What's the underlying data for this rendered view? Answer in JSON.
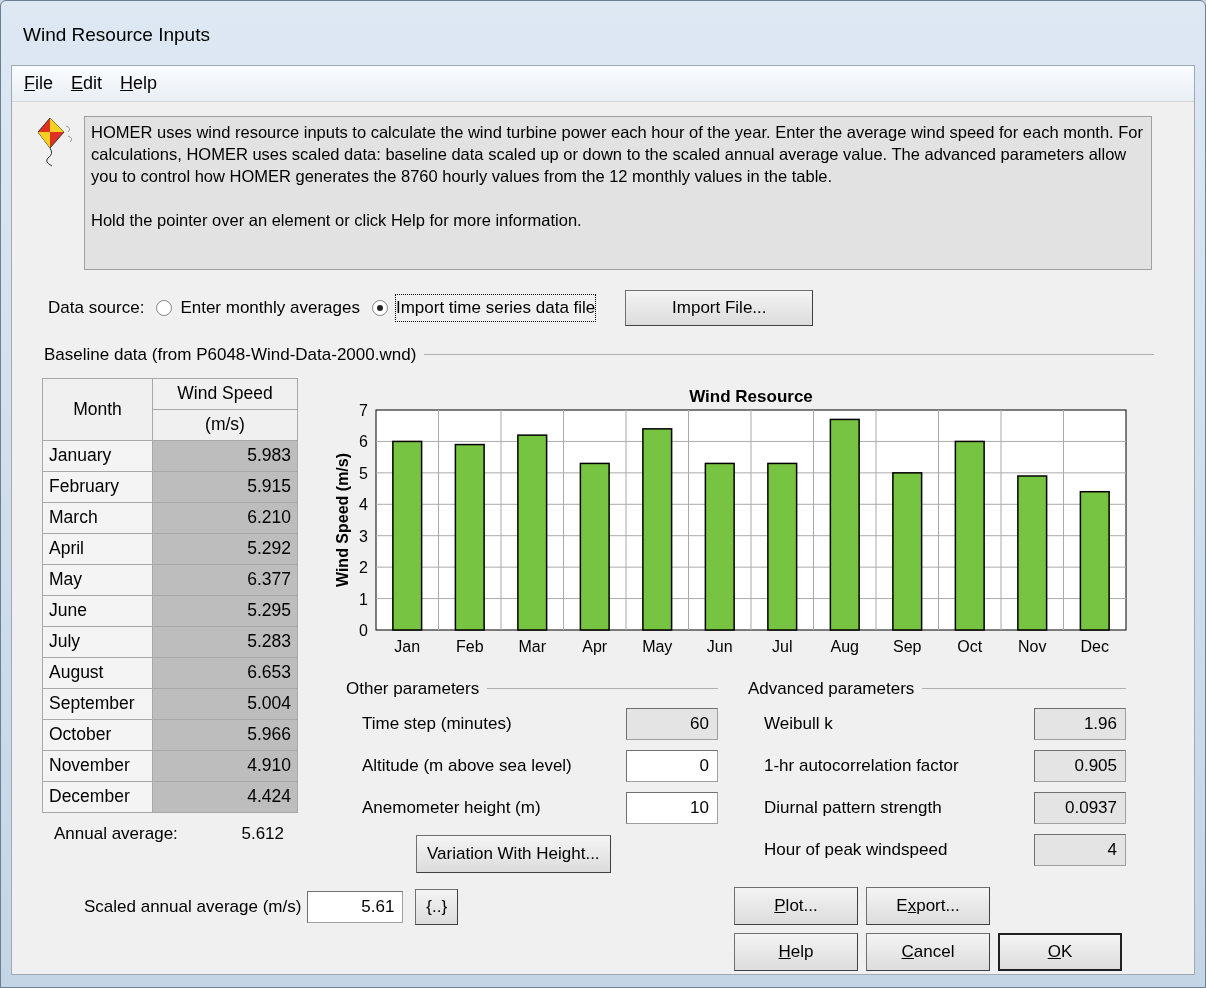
{
  "window": {
    "title": "Wind Resource Inputs"
  },
  "menu": [
    {
      "key": "F",
      "post": "ile"
    },
    {
      "key": "E",
      "post": "dit"
    },
    {
      "key": "H",
      "post": "elp"
    }
  ],
  "info": {
    "paragraphs": [
      "HOMER uses wind resource inputs to calculate the wind turbine power each hour of the year. Enter the average wind speed for each month. For calculations, HOMER uses scaled data: baseline data scaled up or down to the scaled annual average value. The advanced parameters allow you to control how HOMER generates the 8760 hourly values from the 12 monthly values in the table.",
      "Hold the pointer over an element or click Help for more information."
    ]
  },
  "data_source": {
    "label": "Data source:",
    "options": [
      {
        "label": "Enter monthly averages",
        "selected": false
      },
      {
        "label": "Import time series data file",
        "selected": true
      }
    ],
    "button": "Import File..."
  },
  "baseline": {
    "title": "Baseline data (from P6048-Wind-Data-2000.wnd)",
    "table": {
      "columns": [
        "Month",
        "Wind Speed",
        "(m/s)"
      ],
      "rows": [
        {
          "month": "January",
          "value": "5.983"
        },
        {
          "month": "February",
          "value": "5.915"
        },
        {
          "month": "March",
          "value": "6.210"
        },
        {
          "month": "April",
          "value": "5.292"
        },
        {
          "month": "May",
          "value": "6.377"
        },
        {
          "month": "June",
          "value": "5.295"
        },
        {
          "month": "July",
          "value": "5.283"
        },
        {
          "month": "August",
          "value": "6.653"
        },
        {
          "month": "September",
          "value": "5.004"
        },
        {
          "month": "October",
          "value": "5.966"
        },
        {
          "month": "November",
          "value": "4.910"
        },
        {
          "month": "December",
          "value": "4.424"
        }
      ]
    },
    "annual_average": {
      "label": "Annual average:",
      "value": "5.612"
    },
    "chart_data": {
      "type": "bar",
      "title": "Wind Resource",
      "ylabel": "Wind Speed (m/s)",
      "categories": [
        "Jan",
        "Feb",
        "Mar",
        "Apr",
        "May",
        "Jun",
        "Jul",
        "Aug",
        "Sep",
        "Oct",
        "Nov",
        "Dec"
      ],
      "series": [
        {
          "color": "#76c442",
          "values": [
            6.0,
            5.9,
            6.2,
            5.3,
            6.4,
            5.3,
            5.3,
            6.7,
            5.0,
            6.0,
            4.9,
            4.4
          ]
        }
      ],
      "ylim": [
        0,
        7
      ],
      "yticks": [
        0,
        1,
        2,
        3,
        4,
        5,
        6,
        7
      ],
      "grid": true
    }
  },
  "other_parameters": {
    "title": "Other parameters",
    "fields": [
      {
        "label": "Time step (minutes)",
        "value": "60",
        "editable": false
      },
      {
        "label": "Altitude (m above sea level)",
        "value": "0",
        "editable": true
      },
      {
        "label": "Anemometer height (m)",
        "value": "10",
        "editable": true
      }
    ],
    "button": "Variation With Height..."
  },
  "advanced_parameters": {
    "title": "Advanced parameters",
    "fields": [
      {
        "label": "Weibull k",
        "value": "1.96",
        "editable": false
      },
      {
        "label": "1-hr autocorrelation factor",
        "value": "0.905",
        "editable": false
      },
      {
        "label": "Diurnal pattern strength",
        "value": "0.0937",
        "editable": false
      },
      {
        "label": "Hour of peak windspeed",
        "value": "4",
        "editable": false
      }
    ]
  },
  "scaled_average": {
    "label": "Scaled annual average (m/s)",
    "value": "5.61",
    "button": "{..}"
  },
  "buttons": [
    [
      {
        "key": "P",
        "post": "lot...",
        "default": false
      },
      {
        "pre": "E",
        "key": "x",
        "post": "port...",
        "default": false
      }
    ],
    [
      {
        "key": "H",
        "post": "elp",
        "default": false
      },
      {
        "key": "C",
        "post": "ancel",
        "default": false
      },
      {
        "key": "O",
        "post": "K",
        "default": true
      }
    ]
  ]
}
